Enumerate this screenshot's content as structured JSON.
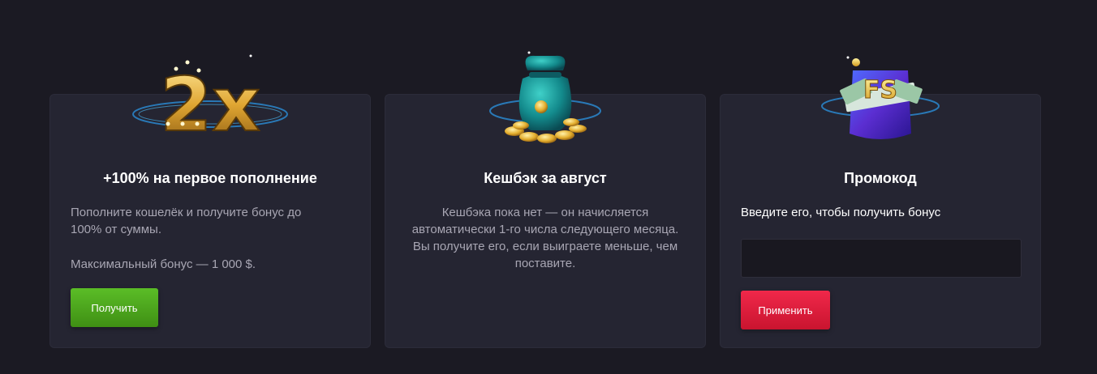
{
  "cards": {
    "deposit": {
      "title": "+100% на первое пополнение",
      "text1": "Пополните кошелёк и получите бонус до 100% от суммы.",
      "text2": "Максимальный бонус — 1 000 $.",
      "button_label": "Получить",
      "image_text": "2x"
    },
    "cashback": {
      "title": "Кешбэк за август",
      "text": "Кешбэка пока нет — он начисляется автоматически 1-го числа следующего месяца. Вы получите его, если выиграете меньше, чем поставите."
    },
    "promo": {
      "title": "Промокод",
      "text": "Введите его, чтобы получить бонус",
      "input_value": "",
      "button_label": "Применить",
      "image_text": "FS"
    }
  },
  "colors": {
    "page_bg": "#1b1a23",
    "card_bg": "#252532",
    "green": "#4ea31d",
    "red": "#e11d3f"
  }
}
